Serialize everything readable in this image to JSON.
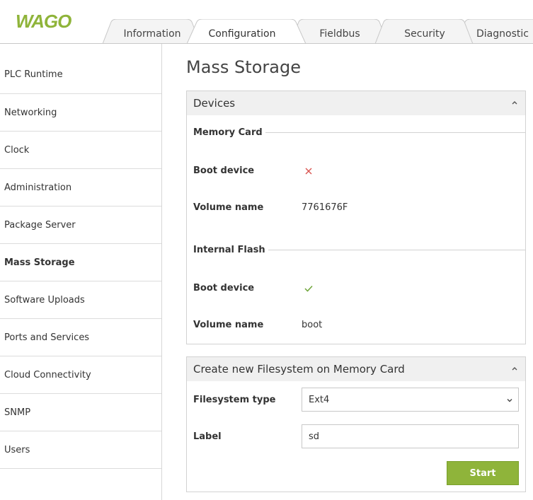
{
  "brand": {
    "logo_text": "WAGO",
    "logo_color": "#8fb43a"
  },
  "tabs": [
    {
      "label": "Information",
      "active": false
    },
    {
      "label": "Configuration",
      "active": true
    },
    {
      "label": "Fieldbus",
      "active": false
    },
    {
      "label": "Security",
      "active": false
    },
    {
      "label": "Diagnostic",
      "active": false
    }
  ],
  "sidebar": {
    "items": [
      {
        "label": "PLC Runtime"
      },
      {
        "label": "Networking"
      },
      {
        "label": "Clock"
      },
      {
        "label": "Administration"
      },
      {
        "label": "Package Server"
      },
      {
        "label": "Mass Storage",
        "active": true
      },
      {
        "label": "Software Uploads"
      },
      {
        "label": "Ports and Services"
      },
      {
        "label": "Cloud Connectivity"
      },
      {
        "label": "SNMP"
      },
      {
        "label": "Users"
      }
    ]
  },
  "main": {
    "title": "Mass Storage",
    "devices_panel": {
      "title": "Devices",
      "memory_card": {
        "group_title": "Memory Card",
        "boot_label": "Boot device",
        "boot_status_icon": "cross-icon",
        "volume_label": "Volume name",
        "volume_value": "7761676F"
      },
      "internal_flash": {
        "group_title": "Internal Flash",
        "boot_label": "Boot device",
        "boot_status_icon": "check-icon",
        "volume_label": "Volume name",
        "volume_value": "boot"
      }
    },
    "filesystem_panel": {
      "title": "Create new Filesystem on Memory Card",
      "type_label": "Filesystem type",
      "type_value": "Ext4",
      "label_label": "Label",
      "label_value": "sd",
      "start_button": "Start"
    }
  },
  "colors": {
    "accent_green": "#8fb43a",
    "error_red": "#d9534f",
    "ok_green": "#6fa53a"
  }
}
